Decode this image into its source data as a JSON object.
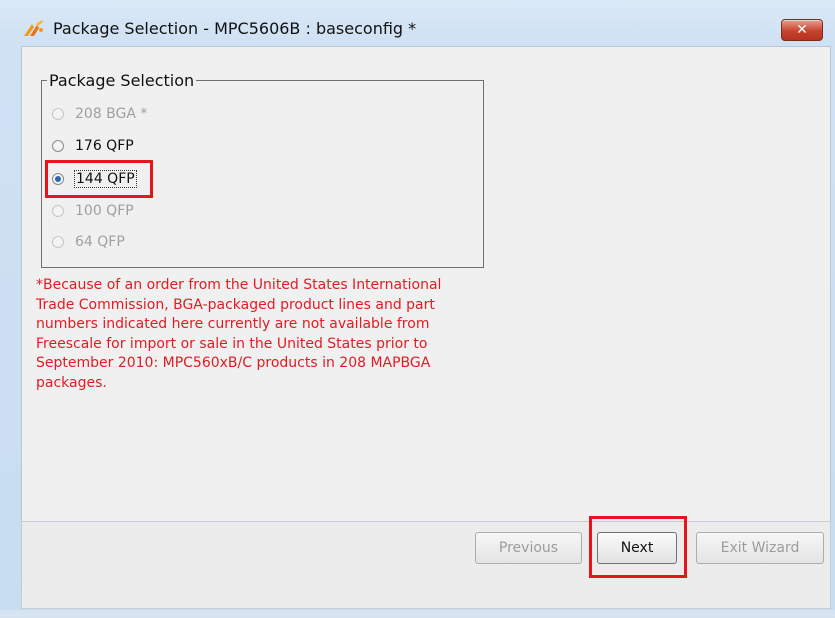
{
  "window": {
    "title": "Package Selection - MPC5606B : baseconfig *",
    "close_label": "✕"
  },
  "group": {
    "legend": "Package Selection",
    "options": [
      {
        "label": "208 BGA *",
        "state": "disabled"
      },
      {
        "label": "176 QFP",
        "state": "enabled"
      },
      {
        "label": "144 QFP",
        "state": "selected"
      },
      {
        "label": "100 QFP",
        "state": "disabled"
      },
      {
        "label": "64 QFP",
        "state": "disabled"
      }
    ]
  },
  "notice": {
    "text": "*Because of an order from the United States International Trade Commission, BGA-packaged product lines and part numbers indicated here currently are not available from Freescale for import or sale in the United States prior to September 2010: MPC560xB/C products in 208 MAPBGA packages.",
    "color": "#e21b23"
  },
  "buttons": {
    "previous": "Previous",
    "next": "Next",
    "exit": "Exit Wizard"
  },
  "colors": {
    "highlight": "#e8141c",
    "radio_checked": "#2a67b2"
  }
}
